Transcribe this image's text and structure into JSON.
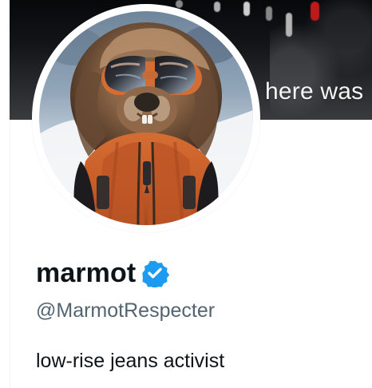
{
  "banner": {
    "caption": "here was"
  },
  "profile": {
    "display_name": "marmot",
    "username": "@MarmotRespecter",
    "bio": "low-rise jeans activist",
    "avatar_subject": "marmot-in-sunglasses",
    "verified": true
  },
  "icons": {
    "verified_badge": "verified-badge-icon"
  },
  "colors": {
    "text_primary": "#0f1419",
    "text_secondary": "#536471",
    "verified_blue": "#1d9bf0",
    "background": "#ffffff",
    "banner_dark": "#111214",
    "jacket_orange": "#d9682c"
  }
}
